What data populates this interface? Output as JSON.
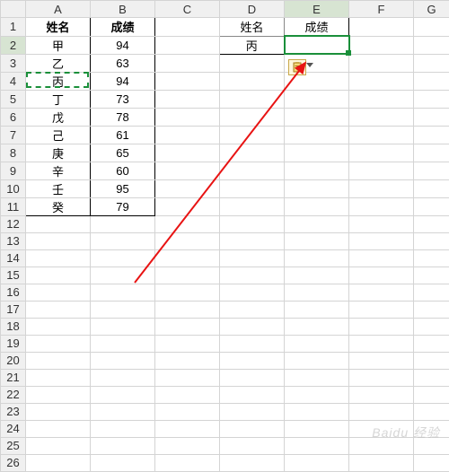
{
  "columns": [
    "A",
    "B",
    "C",
    "D",
    "E",
    "F",
    "G"
  ],
  "rowCount": 26,
  "mainTable": {
    "headers": {
      "name": "姓名",
      "score": "成绩"
    },
    "rows": [
      {
        "name": "甲",
        "score": "94"
      },
      {
        "name": "乙",
        "score": "63"
      },
      {
        "name": "丙",
        "score": "94"
      },
      {
        "name": "丁",
        "score": "73"
      },
      {
        "name": "戊",
        "score": "78"
      },
      {
        "name": "己",
        "score": "61"
      },
      {
        "name": "庚",
        "score": "65"
      },
      {
        "name": "辛",
        "score": "60"
      },
      {
        "name": "壬",
        "score": "95"
      },
      {
        "name": "癸",
        "score": "79"
      }
    ]
  },
  "lookup": {
    "headers": {
      "name": "姓名",
      "score": "成绩"
    },
    "query": {
      "name": "丙",
      "score": ""
    }
  },
  "copySource": {
    "col": "A",
    "row": 4
  },
  "activeCell": {
    "col": "E",
    "row": 2
  },
  "watermark": "Baidu 经验",
  "colors": {
    "selection": "#1a8f3a",
    "arrow": "#e81313"
  }
}
